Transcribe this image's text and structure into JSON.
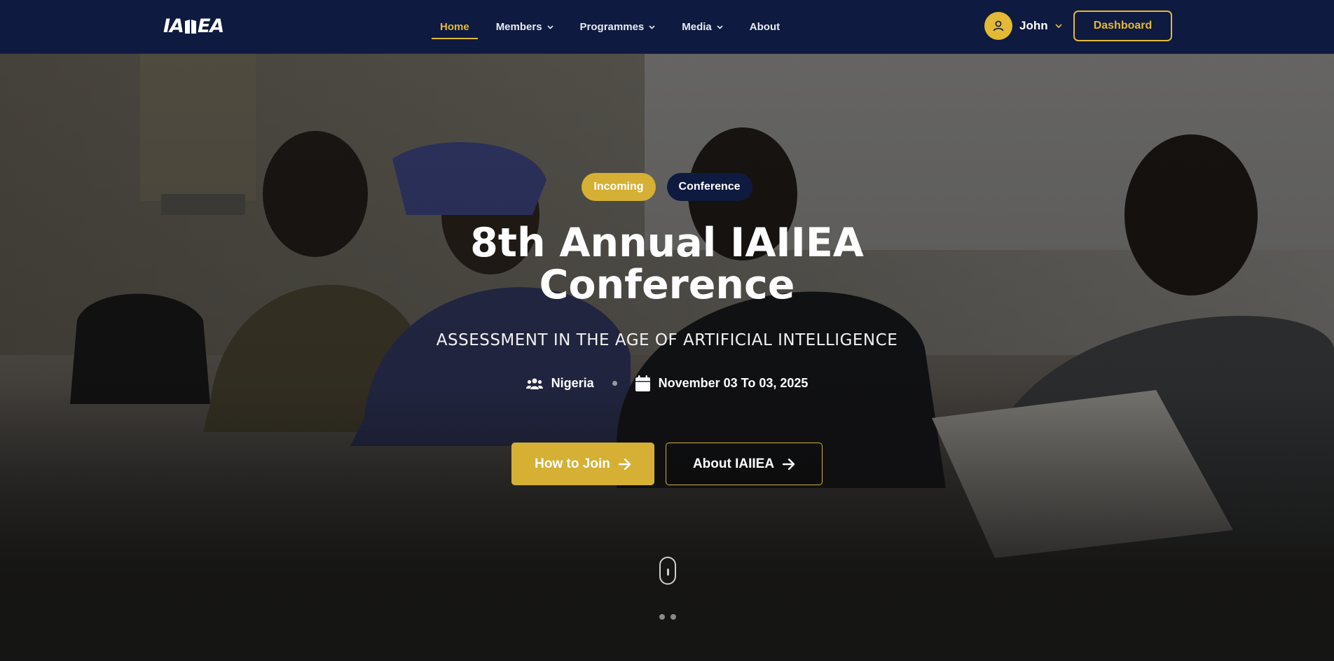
{
  "brand": {
    "logo_text_left": "IA",
    "logo_text_right": "EA"
  },
  "nav": {
    "items": [
      {
        "label": "Home",
        "active": true,
        "dropdown": false
      },
      {
        "label": "Members",
        "active": false,
        "dropdown": true
      },
      {
        "label": "Programmes",
        "active": false,
        "dropdown": true
      },
      {
        "label": "Media",
        "active": false,
        "dropdown": true
      },
      {
        "label": "About",
        "active": false,
        "dropdown": false
      }
    ]
  },
  "user": {
    "name": "John"
  },
  "dashboard_label": "Dashboard",
  "hero": {
    "badges": [
      "Incoming",
      "Conference"
    ],
    "title": "8th Annual IAIIEA Conference",
    "subtitle": "ASSESSMENT IN THE AGE OF ARTIFICIAL INTELLIGENCE",
    "location": "Nigeria",
    "date": "November 03 To 03, 2025",
    "primary_cta": "How to Join",
    "secondary_cta": "About IAIIEA"
  },
  "icons": {
    "chevron": "chevron-down-icon",
    "user": "user-icon",
    "users": "users-icon",
    "calendar": "calendar-icon",
    "arrow": "arrow-right-icon",
    "scroll": "mouse-scroll-icon"
  },
  "colors": {
    "navy": "#0e1a3f",
    "gold": "#d6b034",
    "gold_text": "#e3b935"
  }
}
